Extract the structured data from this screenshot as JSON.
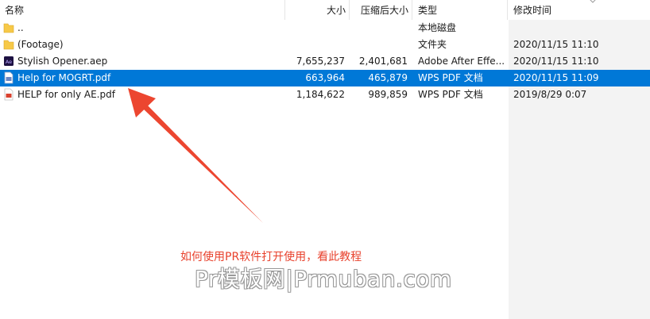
{
  "columns": {
    "name": "名称",
    "size": "大小",
    "compressed": "压缩后大小",
    "type": "类型",
    "modified": "修改时间"
  },
  "files": [
    {
      "name": "..",
      "size": "",
      "compressed": "",
      "type": "本地磁盘",
      "modified": "",
      "icon": "folder-icon"
    },
    {
      "name": "(Footage)",
      "size": "",
      "compressed": "",
      "type": "文件夹",
      "modified": "2020/11/15 11:10",
      "icon": "folder-icon"
    },
    {
      "name": "Stylish Opener.aep",
      "size": "7,655,237",
      "compressed": "2,401,681",
      "type": "Adobe After Effe...",
      "modified": "2020/11/15 11:10",
      "icon": "after-effects-file-icon"
    },
    {
      "name": "Help for MOGRT.pdf",
      "size": "663,964",
      "compressed": "465,879",
      "type": "WPS PDF 文档",
      "modified": "2020/11/15 11:09",
      "icon": "pdf-file-icon",
      "selected": true
    },
    {
      "name": "HELP for only AE.pdf",
      "size": "1,184,622",
      "compressed": "989,859",
      "type": "WPS PDF 文档",
      "modified": "2019/8/29 0:07",
      "icon": "pdf-file-icon"
    }
  ],
  "annotation": "如何使用PR软件打开使用，看此教程",
  "watermark": "Pr模板网|Prmuban.com",
  "colors": {
    "selection": "#0078d7",
    "annotation": "#e8412c",
    "modified_column_bg": "#f3f3f3"
  }
}
